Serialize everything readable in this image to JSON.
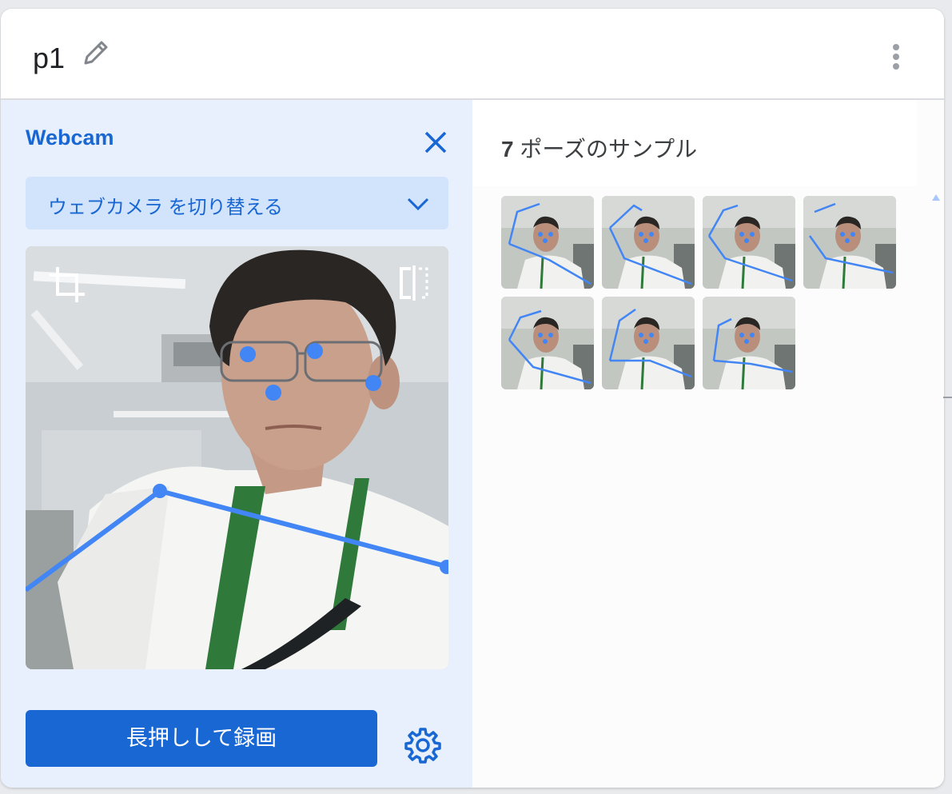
{
  "header": {
    "class_name": "p1",
    "edit_icon": "pencil-icon",
    "menu_icon": "more-vert-icon"
  },
  "webcam": {
    "title": "Webcam",
    "close_icon": "close-icon",
    "switch_label": "ウェブカメラ を切り替える",
    "switch_icon": "chevron-down-icon",
    "crop_icon": "crop-icon",
    "flip_icon": "flip-icon",
    "record_label": "長押しして録画",
    "settings_icon": "gear-icon"
  },
  "samples": {
    "count": "7",
    "label": "ポーズのサンプル",
    "thumbnails": 7
  },
  "colors": {
    "accent": "#1967d2",
    "panel_bg": "#e8f0fe",
    "keypoint": "#4285f4"
  }
}
